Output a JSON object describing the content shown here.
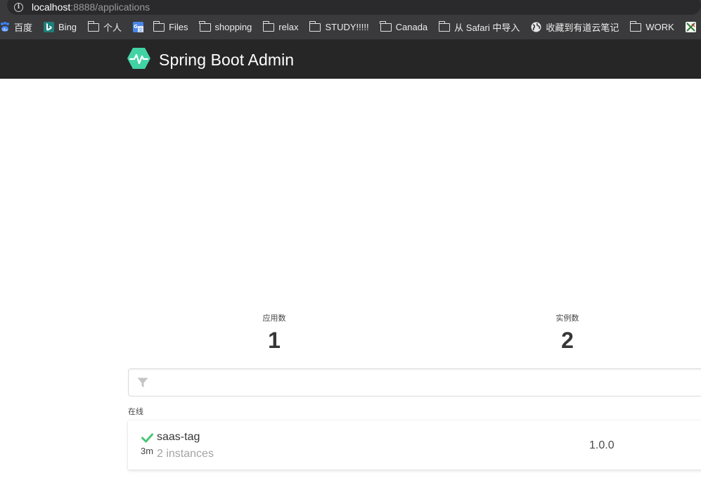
{
  "browser": {
    "url_host": "localhost",
    "url_rest": ":8888/applications"
  },
  "bookmarks": [
    {
      "label": "百度",
      "icon": "baidu-icon"
    },
    {
      "label": "Bing",
      "icon": "bing-icon"
    },
    {
      "label": "个人",
      "icon": "folder-icon"
    },
    {
      "label": "",
      "icon": "google-translate-icon"
    },
    {
      "label": "Files",
      "icon": "folder-icon"
    },
    {
      "label": "shopping",
      "icon": "folder-icon"
    },
    {
      "label": "relax",
      "icon": "folder-icon"
    },
    {
      "label": "STUDY!!!!!",
      "icon": "folder-icon"
    },
    {
      "label": "Canada",
      "icon": "folder-icon"
    },
    {
      "label": "从 Safari 中导入",
      "icon": "folder-icon"
    },
    {
      "label": "收藏到有道云笔记",
      "icon": "globe-icon"
    },
    {
      "label": "WORK",
      "icon": "folder-icon"
    },
    {
      "label": "",
      "icon": "excel-icon"
    }
  ],
  "header": {
    "title": "Spring Boot Admin",
    "logo_color": "#42d3a5"
  },
  "stats": {
    "apps_label": "应用数",
    "apps_value": "1",
    "instances_label": "实例数",
    "instances_value": "2"
  },
  "filter": {
    "placeholder": "",
    "icon": "filter-icon"
  },
  "section": {
    "label": "在线"
  },
  "applications": [
    {
      "name": "saas-tag",
      "instances": "2 instances",
      "version": "1.0.0",
      "uptime": "3m",
      "status_icon": "check-icon",
      "status_color": "#48c774"
    }
  ]
}
